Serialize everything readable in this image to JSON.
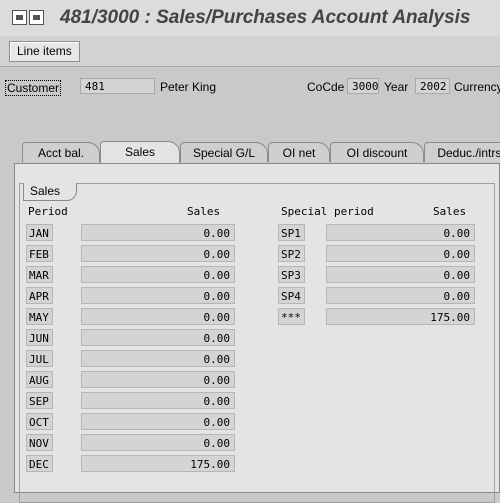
{
  "window": {
    "title": "481/3000 : Sales/Purchases Account Analysis"
  },
  "toolbar": {
    "line_items_label": "Line items"
  },
  "header": {
    "customer_label": "Customer",
    "customer_value": "481",
    "customer_name": "Peter King",
    "cocode_label": "CoCde",
    "cocode_value": "3000",
    "year_label": "Year",
    "year_value": "2002",
    "currency_label": "Currency"
  },
  "tabs": [
    {
      "label": "Acct bal."
    },
    {
      "label": "Sales"
    },
    {
      "label": "Special G/L"
    },
    {
      "label": "OI net"
    },
    {
      "label": "OI discount"
    },
    {
      "label": "Deduc./intrst"
    }
  ],
  "sales": {
    "group_title": "Sales",
    "left": {
      "period_header": "Period",
      "sales_header": "Sales",
      "rows": [
        {
          "period": "JAN",
          "sales": "0.00"
        },
        {
          "period": "FEB",
          "sales": "0.00"
        },
        {
          "period": "MAR",
          "sales": "0.00"
        },
        {
          "period": "APR",
          "sales": "0.00"
        },
        {
          "period": "MAY",
          "sales": "0.00"
        },
        {
          "period": "JUN",
          "sales": "0.00"
        },
        {
          "period": "JUL",
          "sales": "0.00"
        },
        {
          "period": "AUG",
          "sales": "0.00"
        },
        {
          "period": "SEP",
          "sales": "0.00"
        },
        {
          "period": "OCT",
          "sales": "0.00"
        },
        {
          "period": "NOV",
          "sales": "0.00"
        },
        {
          "period": "DEC",
          "sales": "175.00"
        }
      ]
    },
    "right": {
      "period_header": "Special period",
      "sales_header": "Sales",
      "rows": [
        {
          "period": "SP1",
          "sales": "0.00"
        },
        {
          "period": "SP2",
          "sales": "0.00"
        },
        {
          "period": "SP3",
          "sales": "0.00"
        },
        {
          "period": "SP4",
          "sales": "0.00"
        },
        {
          "period": "***",
          "sales": "175.00"
        }
      ]
    }
  }
}
